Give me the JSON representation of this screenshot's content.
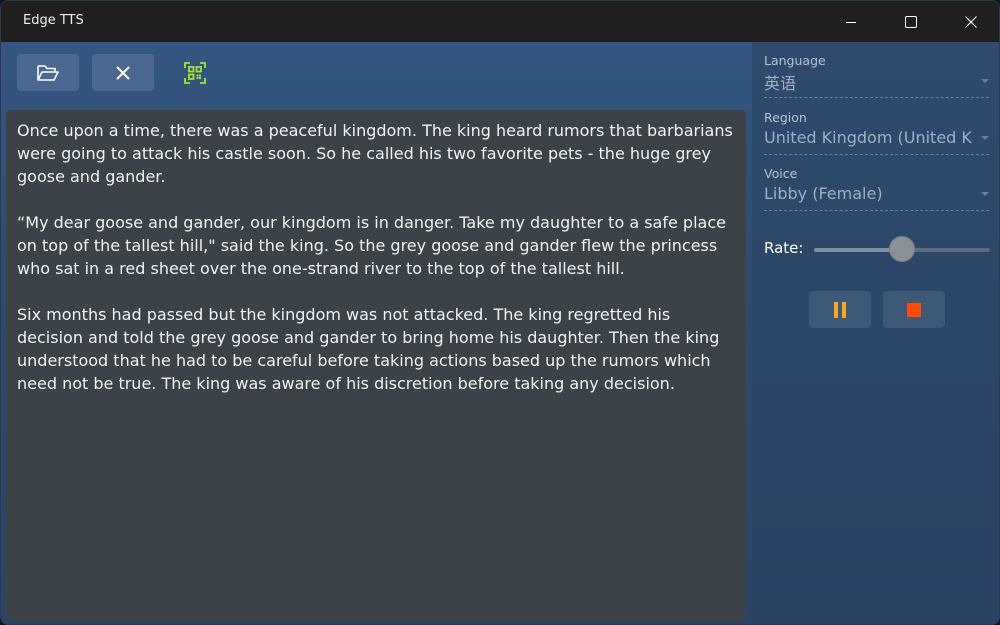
{
  "window": {
    "title": "Edge TTS"
  },
  "toolbar": {
    "open_icon": "folder-open-icon",
    "clear_icon": "close-icon",
    "scan_icon": "qr-scan-icon",
    "scan_color": "#a6e22e"
  },
  "editor": {
    "paragraphs": [
      "Once upon a time, there was a peaceful kingdom. The king heard rumors that barbarians were going to attack his castle soon. So he called his two favorite pets - the huge grey goose and gander.",
      "“My dear goose and gander, our kingdom is in danger. Take my daughter to a safe place on top of the tallest hill,\" said the king. So the grey goose and gander flew the princess who sat in a red sheet over the one-strand river to the top of the tallest hill.",
      "Six months had passed but the kingdom was not attacked. The king regretted his decision and told the grey goose and gander to bring home his daughter. Then the king understood that he had to be careful before taking actions based up the rumors which need not be true. The king was aware of his discretion before taking any decision."
    ]
  },
  "settings": {
    "language": {
      "label": "Language",
      "value": "英语"
    },
    "region": {
      "label": "Region",
      "value": "United Kingdom (United K"
    },
    "voice": {
      "label": "Voice",
      "value": "Libby (Female)"
    },
    "rate": {
      "label": "Rate:",
      "value": 0.5
    }
  },
  "controls": {
    "pause_icon": "pause-icon",
    "stop_icon": "stop-icon",
    "pause_color": "#f5a623",
    "stop_color": "#ff4a0a"
  }
}
